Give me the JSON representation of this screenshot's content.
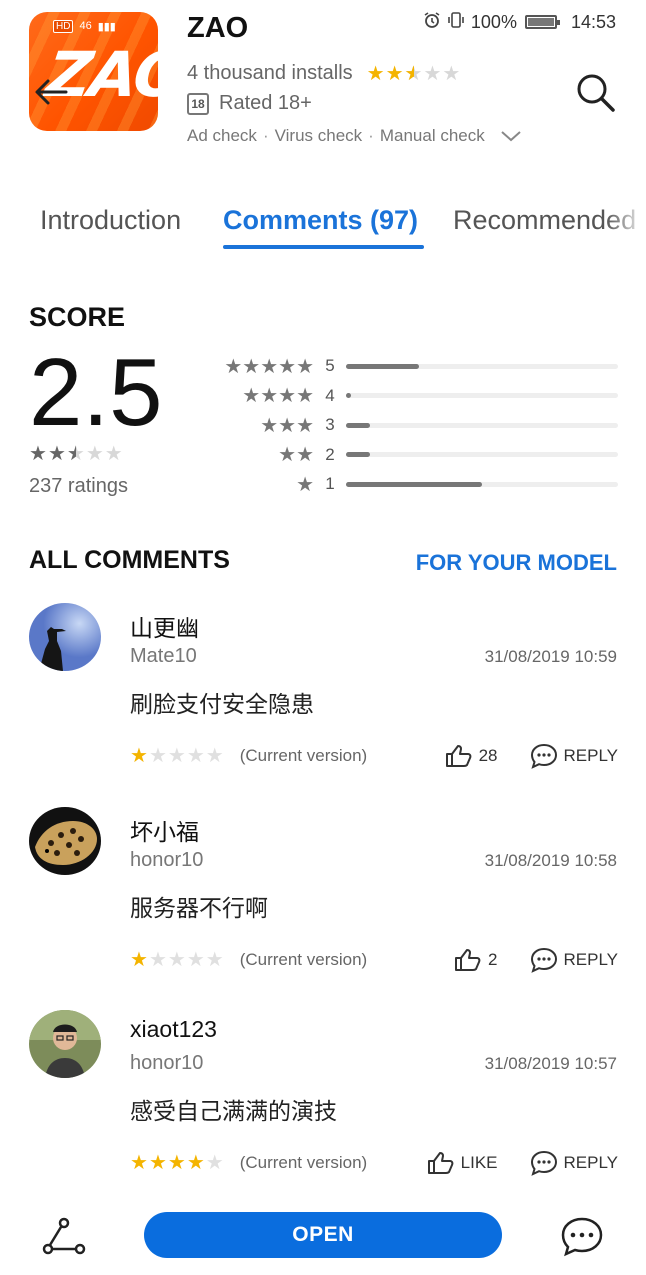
{
  "status_bar": {
    "battery": "100%",
    "time": "14:53"
  },
  "app": {
    "icon_text": "ZAO",
    "icon_status_hd": "HD",
    "icon_status_net": "46",
    "name": "ZAO",
    "installs": "4 thousand installs",
    "rating_stars": 2.5,
    "age_badge": "18",
    "age_rating": "Rated 18+",
    "checks": [
      "Ad check",
      "Virus check",
      "Manual check"
    ],
    "check_separator": "·"
  },
  "tabs": [
    {
      "label": "Introduction",
      "active": false
    },
    {
      "label": "Comments (97)",
      "active": true
    },
    {
      "label": "Recommended",
      "active": false
    }
  ],
  "score": {
    "title": "SCORE",
    "value": "2.5",
    "stars": 2.5,
    "ratings_count": "237 ratings",
    "distribution": [
      {
        "stars": 5,
        "label": "5",
        "fraction": 0.27
      },
      {
        "stars": 4,
        "label": "4",
        "fraction": 0.02
      },
      {
        "stars": 3,
        "label": "3",
        "fraction": 0.09
      },
      {
        "stars": 2,
        "label": "2",
        "fraction": 0.09
      },
      {
        "stars": 1,
        "label": "1",
        "fraction": 0.5
      }
    ]
  },
  "comments_section": {
    "title": "ALL COMMENTS",
    "filter": "FOR YOUR MODEL"
  },
  "comments": [
    {
      "name": "山更幽",
      "device": "Mate10",
      "date": "31/08/2019 10:59",
      "text": "刷脸支付安全隐患",
      "stars": 1,
      "version": "(Current version)",
      "likes": "28",
      "reply": "REPLY",
      "avatar": "silhouette-avatar"
    },
    {
      "name": "坏小福",
      "device": "honor10",
      "date": "31/08/2019 10:58",
      "text": "服务器不行啊",
      "stars": 1,
      "version": "(Current version)",
      "likes": "2",
      "reply": "REPLY",
      "avatar": "leopard-avatar"
    },
    {
      "name": "xiaot123",
      "device": "honor10",
      "date": "31/08/2019 10:57",
      "text": "感受自己满满的演技",
      "stars": 4,
      "version": "(Current version)",
      "likes": "LIKE",
      "reply": "REPLY",
      "avatar": "person-avatar"
    }
  ],
  "bottom_bar": {
    "open_label": "OPEN"
  },
  "colors": {
    "accent": "#1a73d9",
    "open_button": "#0a6dde",
    "star": "#f4b400",
    "icon_orange": "#ff5400"
  }
}
